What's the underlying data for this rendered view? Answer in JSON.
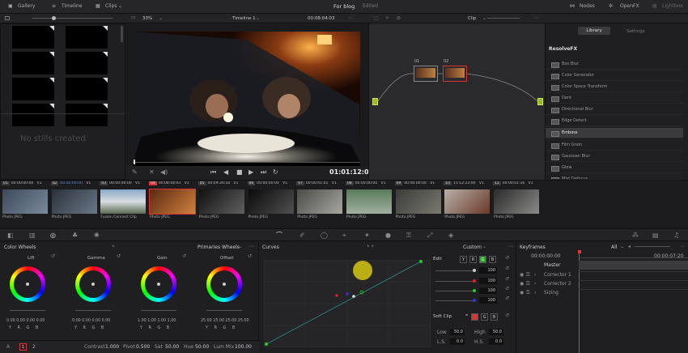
{
  "topbar": {
    "gallery": "Gallery",
    "timeline_tab": "Timeline",
    "clips": "Clips",
    "project_title": "For blog",
    "edited": "Edited",
    "nodes": "Nodes",
    "openfx": "OpenFX",
    "lightbox": "Lightbox"
  },
  "viewer": {
    "zoom": "33%",
    "timeline_name": "Timeline 1",
    "timecode_top": "00:08:04:03",
    "timecode": "01:01:12:06"
  },
  "gallery": {
    "empty_text": "No stills created"
  },
  "nodes": {
    "mode": "Clip",
    "node1_label": "01",
    "node2_label": "02"
  },
  "library": {
    "tab_library": "Library",
    "tab_settings": "Settings",
    "section": "ResolveFX",
    "items": [
      "Box Blur",
      "Color Generator",
      "Color Space Transform",
      "Dent",
      "Directional Blur",
      "Edge Detect",
      "Emboss",
      "Film Grain",
      "Gaussian Blur",
      "Glow",
      "Mist Defocus"
    ],
    "selected": "Emboss"
  },
  "clips": [
    {
      "num": "01",
      "tc": "00:00:00:00",
      "track": "V1",
      "label": "Photo JPEG"
    },
    {
      "num": "02",
      "tc": "00:00:00:00",
      "track": "V1",
      "label": "Photo JPEG"
    },
    {
      "num": "03",
      "tc": "00:00:00:00",
      "track": "V1",
      "label": "Fusion Connect Clip"
    },
    {
      "num": "04",
      "tc": "00:08:04:03",
      "track": "V1",
      "label": "Photo JPEG"
    },
    {
      "num": "05",
      "tc": "00:09:39:18",
      "track": "V1",
      "label": "Photo JPEG"
    },
    {
      "num": "06",
      "tc": "00:00:00:00",
      "track": "V1",
      "label": "Photo JPEG"
    },
    {
      "num": "07",
      "tc": "00:00:01:01",
      "track": "V1",
      "label": "Photo JPEG"
    },
    {
      "num": "08",
      "tc": "00:00:00:00",
      "track": "V1",
      "label": "Photo JPEG"
    },
    {
      "num": "09",
      "tc": "00:00:00:00",
      "track": "V1",
      "label": "Photo JPEG"
    },
    {
      "num": "10",
      "tc": "15:12:23:00",
      "track": "V1",
      "label": "Photo JPEG"
    },
    {
      "num": "11",
      "tc": "00:00:01:16",
      "track": "V1",
      "label": "Photo JPEG"
    }
  ],
  "wheels": {
    "title": "Color Wheels",
    "mode": "Primaries Wheels",
    "lift": {
      "label": "Lift",
      "values": [
        "0.00",
        "0.00",
        "0.00",
        "0.00"
      ]
    },
    "gamma": {
      "label": "Gamma",
      "values": [
        "0.00",
        "0.00",
        "0.00",
        "0.00"
      ]
    },
    "gain": {
      "label": "Gain",
      "values": [
        "1.00",
        "1.00",
        "1.00",
        "1.00"
      ]
    },
    "offset": {
      "label": "Offset",
      "values": [
        "25.00",
        "25.00",
        "25.00",
        "25.00"
      ]
    },
    "channels": [
      "Y",
      "R",
      "G",
      "B"
    ],
    "contrast_label": "Contrast",
    "contrast": "1.000",
    "pivot_label": "Pivot",
    "pivot": "0.500",
    "sat_label": "Sat",
    "sat": "50.00",
    "hue_label": "Hue",
    "hue": "50.00",
    "lummix_label": "Lum Mix",
    "lummix": "100.00",
    "page1": "1",
    "page2": "2"
  },
  "curves": {
    "title": "Curves",
    "mode": "Custom",
    "edit": "Edit",
    "ch": [
      "Y",
      "R",
      "G",
      "B"
    ],
    "vals": [
      "100",
      "100",
      "100",
      "100"
    ],
    "softclip": "Soft Clip",
    "low_label": "Low",
    "low": "50.0",
    "high_label": "High",
    "high": "50.0",
    "ls_label": "L.S.",
    "ls": "0.0",
    "hs_label": "H.S.",
    "hs": "0.0"
  },
  "keyframes": {
    "title": "Keyframes",
    "filter": "All",
    "tc1": "00:00:00:00",
    "tc2": "00:00:07:20",
    "rows": [
      "Master",
      "Corrector 1",
      "Corrector 2",
      "Sizing"
    ]
  },
  "colors": {
    "accent": "#d33",
    "playhead": "#e33",
    "green": "#2a2",
    "yellow": "#cc0"
  }
}
